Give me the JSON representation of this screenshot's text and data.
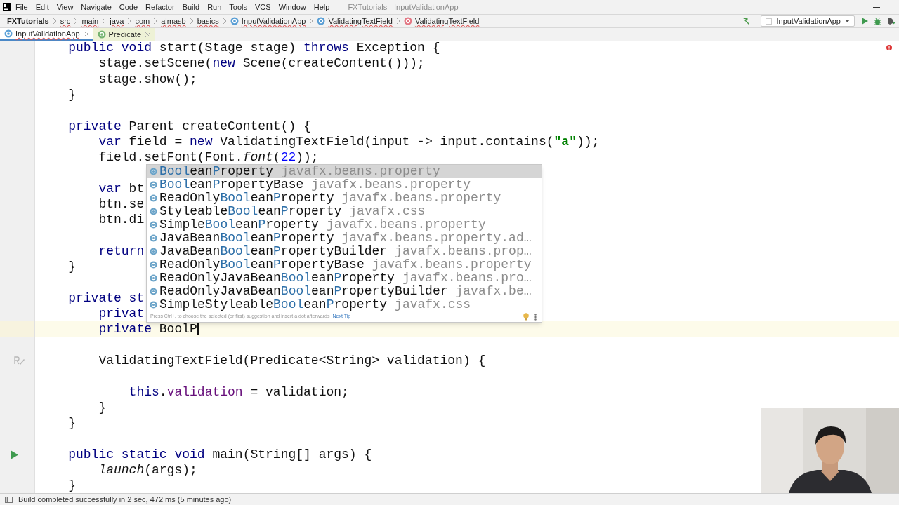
{
  "window": {
    "title": "FXTutorials - InputValidationApp"
  },
  "menu": [
    "File",
    "Edit",
    "View",
    "Navigate",
    "Code",
    "Refactor",
    "Build",
    "Run",
    "Tools",
    "VCS",
    "Window",
    "Help"
  ],
  "breadcrumbs": [
    {
      "label": "FXTutorials",
      "kind": "project",
      "problem": false
    },
    {
      "label": "src",
      "kind": "folder",
      "problem": true
    },
    {
      "label": "main",
      "kind": "folder",
      "problem": true
    },
    {
      "label": "java",
      "kind": "folder",
      "problem": true
    },
    {
      "label": "com",
      "kind": "folder",
      "problem": true
    },
    {
      "label": "almasb",
      "kind": "folder",
      "problem": true
    },
    {
      "label": "basics",
      "kind": "folder",
      "problem": true
    },
    {
      "label": "InputValidationApp",
      "kind": "class",
      "problem": true
    },
    {
      "label": "ValidatingTextField",
      "kind": "class",
      "problem": true
    },
    {
      "label": "ValidatingTextField",
      "kind": "method",
      "problem": true
    }
  ],
  "run_config": "InputValidationApp",
  "tabs": [
    {
      "label": "InputValidationApp",
      "kind": "class",
      "selected": true,
      "problem": true
    },
    {
      "label": "Predicate",
      "kind": "interface",
      "selected": false,
      "problem": false
    }
  ],
  "editor": {
    "lines": [
      {
        "kind": "code",
        "segments": [
          {
            "kind": "keyword",
            "text": "    public void "
          },
          {
            "kind": "plain",
            "text": "start(Stage stage) "
          },
          {
            "kind": "keyword",
            "text": "throws "
          },
          {
            "kind": "plain",
            "text": "Exception {"
          }
        ]
      },
      {
        "kind": "code",
        "segments": [
          {
            "kind": "plain",
            "text": "        stage.setScene("
          },
          {
            "kind": "keyword",
            "text": "new "
          },
          {
            "kind": "plain",
            "text": "Scene(createContent()));"
          }
        ]
      },
      {
        "kind": "code",
        "segments": [
          {
            "kind": "plain",
            "text": "        stage.show();"
          }
        ]
      },
      {
        "kind": "code",
        "segments": [
          {
            "kind": "plain",
            "text": "    }"
          }
        ]
      },
      {
        "kind": "blank"
      },
      {
        "kind": "code",
        "segments": [
          {
            "kind": "keyword",
            "text": "    private "
          },
          {
            "kind": "plain",
            "text": "Parent createContent() {"
          }
        ]
      },
      {
        "kind": "code",
        "segments": [
          {
            "kind": "keyword",
            "text": "        var "
          },
          {
            "kind": "plain",
            "text": "field = "
          },
          {
            "kind": "keyword",
            "text": "new "
          },
          {
            "kind": "plain",
            "text": "ValidatingTextField(input -> input.contains("
          },
          {
            "kind": "string",
            "text": "\"a\""
          },
          {
            "kind": "plain",
            "text": "));"
          }
        ]
      },
      {
        "kind": "code",
        "segments": [
          {
            "kind": "plain",
            "text": "        field.setFont(Font."
          },
          {
            "kind": "italic",
            "text": "font"
          },
          {
            "kind": "plain",
            "text": "("
          },
          {
            "kind": "number",
            "text": "22"
          },
          {
            "kind": "plain",
            "text": "));"
          }
        ]
      },
      {
        "kind": "blank"
      },
      {
        "kind": "code",
        "segments": [
          {
            "kind": "keyword",
            "text": "        var "
          },
          {
            "kind": "plain",
            "text": "bt"
          }
        ]
      },
      {
        "kind": "code",
        "segments": [
          {
            "kind": "plain",
            "text": "        btn.se"
          }
        ]
      },
      {
        "kind": "code",
        "segments": [
          {
            "kind": "plain",
            "text": "        btn.di"
          }
        ]
      },
      {
        "kind": "blank"
      },
      {
        "kind": "code",
        "segments": [
          {
            "kind": "keyword",
            "text": "        return"
          }
        ]
      },
      {
        "kind": "code",
        "segments": [
          {
            "kind": "plain",
            "text": "    }"
          }
        ]
      },
      {
        "kind": "blank"
      },
      {
        "kind": "code",
        "segments": [
          {
            "kind": "keyword",
            "text": "    private st"
          }
        ]
      },
      {
        "kind": "code",
        "segments": [
          {
            "kind": "keyword",
            "text": "        privat"
          }
        ]
      },
      {
        "kind": "caret",
        "segments": [
          {
            "kind": "keyword",
            "text": "        private "
          },
          {
            "kind": "plain",
            "text": "BoolP"
          }
        ]
      },
      {
        "kind": "blank"
      },
      {
        "kind": "edited",
        "segments": [
          {
            "kind": "plain",
            "text": "        ValidatingTextField(Predicate<String> validation) {"
          }
        ]
      },
      {
        "kind": "blank"
      },
      {
        "kind": "code",
        "segments": [
          {
            "kind": "keyword",
            "text": "            this"
          },
          {
            "kind": "plain",
            "text": "."
          },
          {
            "kind": "field",
            "text": "validation"
          },
          {
            "kind": "plain",
            "text": " = validation;"
          }
        ]
      },
      {
        "kind": "code",
        "segments": [
          {
            "kind": "plain",
            "text": "        }"
          }
        ]
      },
      {
        "kind": "code",
        "segments": [
          {
            "kind": "plain",
            "text": "    }"
          }
        ]
      },
      {
        "kind": "blank"
      },
      {
        "kind": "runnable",
        "segments": [
          {
            "kind": "keyword",
            "text": "    public static void "
          },
          {
            "kind": "plain",
            "text": "main(String[] args) {"
          }
        ]
      },
      {
        "kind": "code",
        "segments": [
          {
            "kind": "italic",
            "text": "        launch"
          },
          {
            "kind": "plain",
            "text": "(args);"
          }
        ]
      },
      {
        "kind": "code",
        "segments": [
          {
            "kind": "plain",
            "text": "    }"
          }
        ]
      }
    ]
  },
  "completion": {
    "items": [
      {
        "selected": true,
        "name_parts": [
          {
            "text": "Bool",
            "match": true
          },
          {
            "text": "ean",
            "match": false
          },
          {
            "text": "P",
            "match": true
          },
          {
            "text": "roperty",
            "match": false
          }
        ],
        "package": "javafx.beans.property"
      },
      {
        "selected": false,
        "name_parts": [
          {
            "text": "Bool",
            "match": true
          },
          {
            "text": "ean",
            "match": false
          },
          {
            "text": "P",
            "match": true
          },
          {
            "text": "ropertyBase",
            "match": false
          }
        ],
        "package": "javafx.beans.property"
      },
      {
        "selected": false,
        "name_parts": [
          {
            "text": "ReadOnly",
            "match": false
          },
          {
            "text": "Bool",
            "match": true
          },
          {
            "text": "ean",
            "match": false
          },
          {
            "text": "P",
            "match": true
          },
          {
            "text": "roperty",
            "match": false
          }
        ],
        "package": "javafx.beans.property"
      },
      {
        "selected": false,
        "name_parts": [
          {
            "text": "Styleable",
            "match": false
          },
          {
            "text": "Bool",
            "match": true
          },
          {
            "text": "ean",
            "match": false
          },
          {
            "text": "P",
            "match": true
          },
          {
            "text": "roperty",
            "match": false
          }
        ],
        "package": "javafx.css"
      },
      {
        "selected": false,
        "name_parts": [
          {
            "text": "Simple",
            "match": false
          },
          {
            "text": "Bool",
            "match": true
          },
          {
            "text": "ean",
            "match": false
          },
          {
            "text": "P",
            "match": true
          },
          {
            "text": "roperty",
            "match": false
          }
        ],
        "package": "javafx.beans.property"
      },
      {
        "selected": false,
        "name_parts": [
          {
            "text": "JavaBean",
            "match": false
          },
          {
            "text": "Bool",
            "match": true
          },
          {
            "text": "ean",
            "match": false
          },
          {
            "text": "P",
            "match": true
          },
          {
            "text": "roperty",
            "match": false
          }
        ],
        "package": "javafx.beans.property.ad…"
      },
      {
        "selected": false,
        "name_parts": [
          {
            "text": "JavaBean",
            "match": false
          },
          {
            "text": "Bool",
            "match": true
          },
          {
            "text": "ean",
            "match": false
          },
          {
            "text": "P",
            "match": true
          },
          {
            "text": "ropertyBuilder",
            "match": false
          }
        ],
        "package": "javafx.beans.prop…"
      },
      {
        "selected": false,
        "name_parts": [
          {
            "text": "ReadOnly",
            "match": false
          },
          {
            "text": "Bool",
            "match": true
          },
          {
            "text": "ean",
            "match": false
          },
          {
            "text": "P",
            "match": true
          },
          {
            "text": "ropertyBase",
            "match": false
          }
        ],
        "package": "javafx.beans.property"
      },
      {
        "selected": false,
        "name_parts": [
          {
            "text": "ReadOnlyJavaBean",
            "match": false
          },
          {
            "text": "Bool",
            "match": true
          },
          {
            "text": "ean",
            "match": false
          },
          {
            "text": "P",
            "match": true
          },
          {
            "text": "roperty",
            "match": false
          }
        ],
        "package": "javafx.beans.pro…"
      },
      {
        "selected": false,
        "name_parts": [
          {
            "text": "ReadOnlyJavaBean",
            "match": false
          },
          {
            "text": "Bool",
            "match": true
          },
          {
            "text": "ean",
            "match": false
          },
          {
            "text": "P",
            "match": true
          },
          {
            "text": "ropertyBuilder",
            "match": false
          }
        ],
        "package": "javafx.be…"
      },
      {
        "selected": false,
        "name_parts": [
          {
            "text": "SimpleStyleable",
            "match": false
          },
          {
            "text": "Bool",
            "match": true
          },
          {
            "text": "ean",
            "match": false
          },
          {
            "text": "P",
            "match": true
          },
          {
            "text": "roperty",
            "match": false
          }
        ],
        "package": "javafx.css"
      }
    ],
    "hint": "Press Ctrl+. to choose the selected (or first) suggestion and insert a dot afterwards",
    "next_tip": "Next Tip"
  },
  "status_bar": {
    "message": "Build completed successfully in 2 sec, 472 ms (5 minutes ago)"
  }
}
